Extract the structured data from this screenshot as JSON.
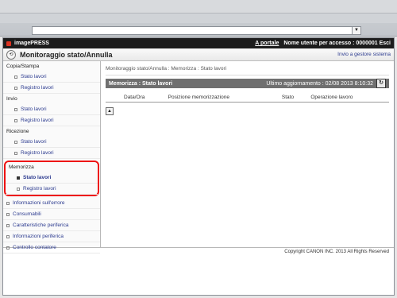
{
  "app": {
    "brand": "imagePRESS",
    "portal_link": "A portale",
    "user_text": "Nome utente per accesso : 0000001 Esci",
    "page_title": "Monitoraggio stato/Annulla",
    "send_link": "Invio a gestore sistema"
  },
  "sidebar": {
    "groups": [
      {
        "title": "Copia/Stampa",
        "items": [
          "Stato lavori",
          "Registro lavori"
        ]
      },
      {
        "title": "Invio",
        "items": [
          "Stato lavori",
          "Registro lavori"
        ]
      },
      {
        "title": "Ricezione",
        "items": [
          "Stato lavori",
          "Registro lavori"
        ]
      },
      {
        "title": "Memorizza",
        "items": [
          "Stato lavori",
          "Registro lavori"
        ]
      }
    ],
    "top_items": [
      "Informazioni sull'errore",
      "Consumabili",
      "Caratteristiche periferica",
      "Informazioni periferica",
      "Controllo contatore"
    ]
  },
  "content": {
    "breadcrumb": "Monitoraggio stato/Annulla : Memorizza : Stato lavori",
    "panel_title": "Memorizza : Stato lavori",
    "last_update": "Ultimo aggiornamento : 02/08 2013 8:10:32",
    "table_headers": [
      "Data/Ora",
      "Posizione memorizzazione",
      "Stato",
      "Operazione lavoro"
    ]
  },
  "footer": {
    "copyright": "Copyright CANON INC. 2013 All Rights Reserved"
  }
}
